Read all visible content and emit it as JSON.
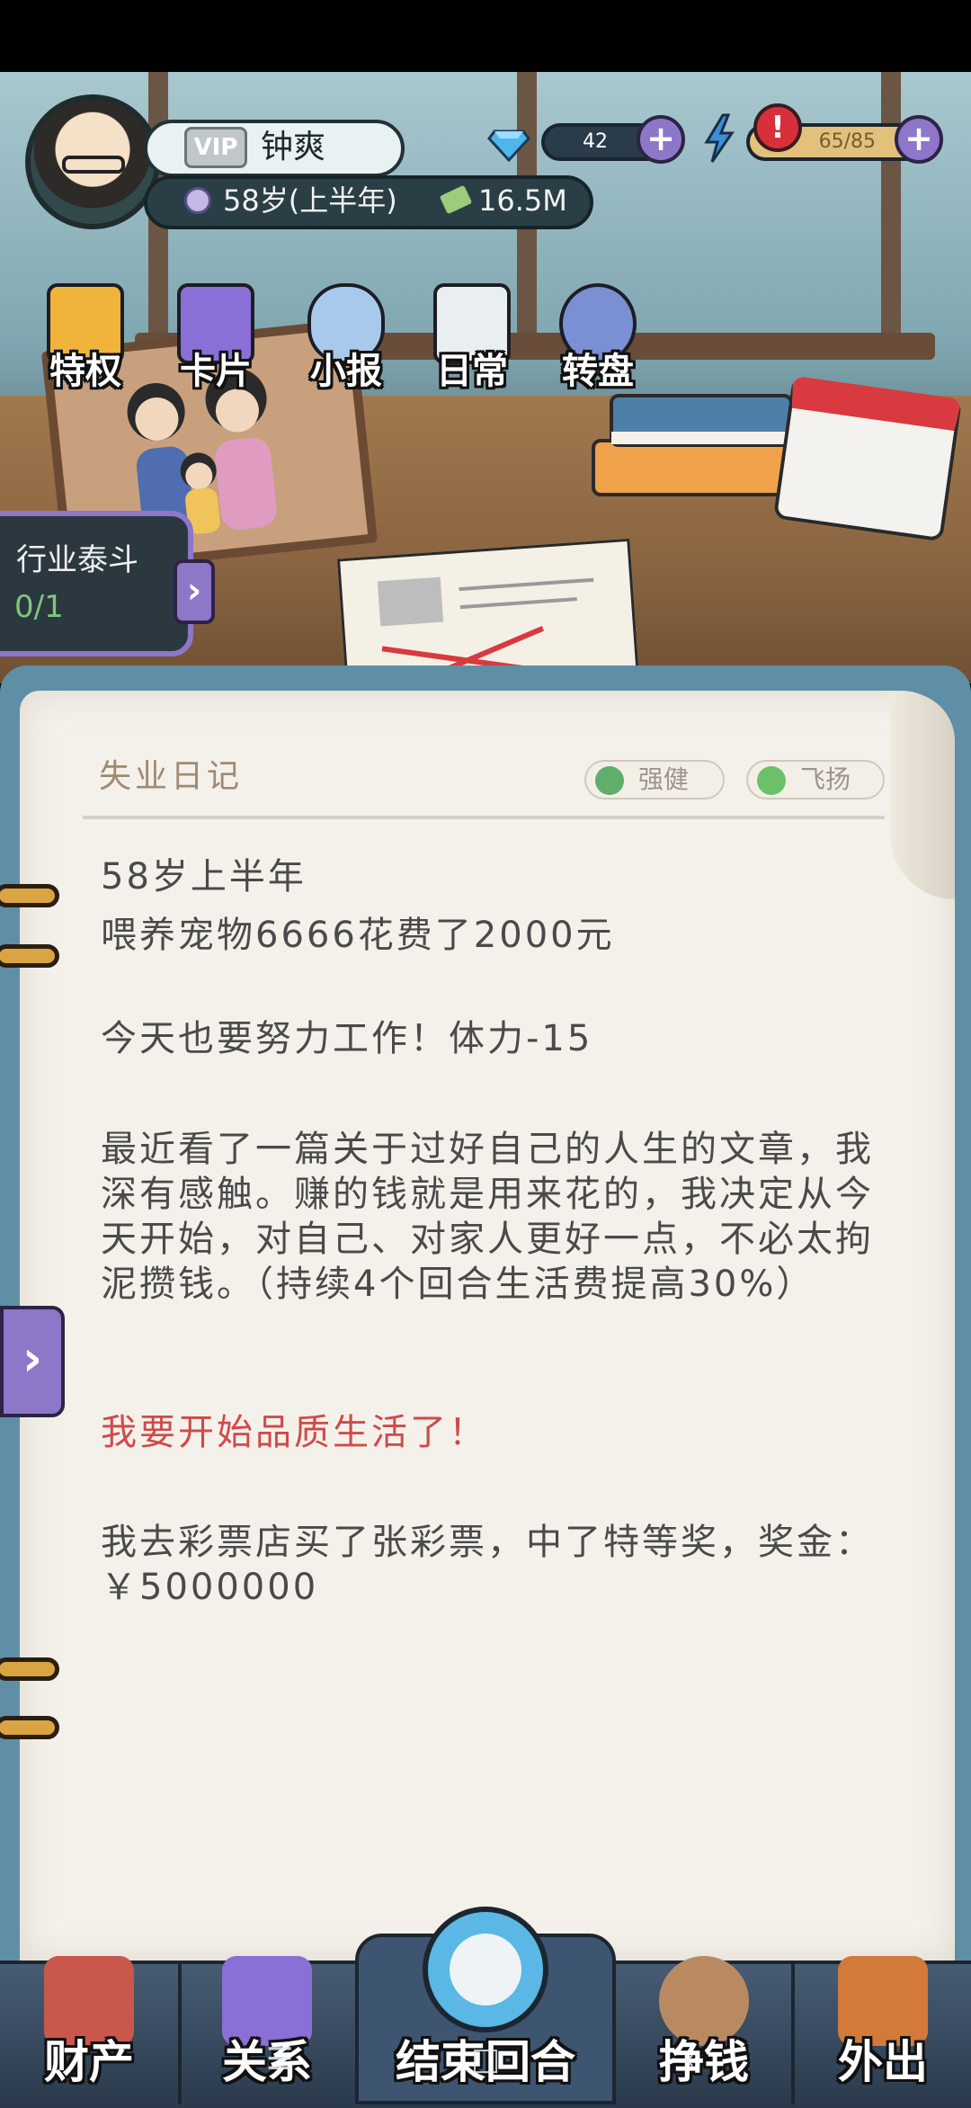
{
  "player": {
    "name": "钟爽",
    "vip_label": "VIP",
    "age": "58岁(上半年)",
    "cash": "16.5M"
  },
  "resources": {
    "diamonds": "42",
    "energy": "65/85"
  },
  "top_menu": [
    {
      "label": "特权",
      "icon": "vip-icon"
    },
    {
      "label": "卡片",
      "icon": "cards-icon"
    },
    {
      "label": "小报",
      "icon": "newspaper-icon"
    },
    {
      "label": "日常",
      "icon": "clipboard-icon"
    },
    {
      "label": "转盘",
      "icon": "wheel-icon"
    }
  ],
  "mission": {
    "title": "行业泰斗",
    "progress": "0/1"
  },
  "diary": {
    "title": "失业日记",
    "tags": [
      {
        "label": "强健",
        "icon": "health-icon",
        "color": "#5fae6b"
      },
      {
        "label": "飞扬",
        "icon": "heart-icon",
        "color": "#6cc06a"
      }
    ],
    "entries": [
      "58岁上半年",
      "喂养宠物6666花费了2000元",
      "今天也要努力工作！体力-15",
      "最近看了一篇关于过好自己的人生的文章，我深有感触。赚的钱就是用来花的，我决定从今天开始，对自己、对家人更好一点，不必太拘泥攒钱。（持续4个回合生活费提高30%）",
      "我要开始品质生活了！",
      "我去彩票店买了张彩票，中了特等奖，奖金：￥5000000"
    ]
  },
  "bottom_nav": {
    "assets": "财产",
    "relations": "关系",
    "end_turn": "结束回合",
    "earn": "挣钱",
    "go_out": "外出"
  },
  "colors": {
    "accent": "#8e76c9",
    "highlight_text": "#d04a48",
    "notebook": "#5e8fa6"
  }
}
